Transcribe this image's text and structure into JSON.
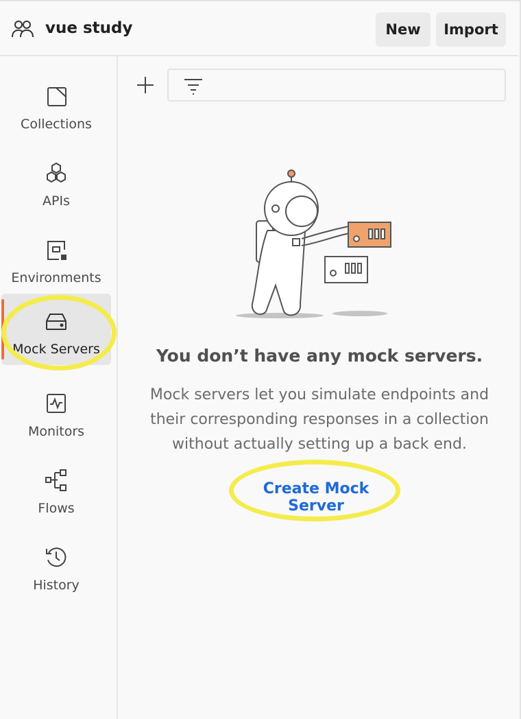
{
  "header": {
    "workspace_title": "vue study",
    "new_label": "New",
    "import_label": "Import"
  },
  "sidebar": {
    "items": [
      {
        "label": "Collections",
        "icon": "collections-icon"
      },
      {
        "label": "APIs",
        "icon": "apis-icon"
      },
      {
        "label": "Environments",
        "icon": "environments-icon"
      },
      {
        "label": "Mock Servers",
        "icon": "mock-servers-icon",
        "active": true
      },
      {
        "label": "Monitors",
        "icon": "monitors-icon"
      },
      {
        "label": "Flows",
        "icon": "flows-icon"
      },
      {
        "label": "History",
        "icon": "history-icon"
      }
    ]
  },
  "main": {
    "empty_title": "You don’t have any mock servers.",
    "empty_description": "Mock servers let you simulate endpoints and their corresponding responses in a collection without actually setting up a back end.",
    "create_link": "Create Mock Server"
  },
  "colors": {
    "accent": "#f26b3a",
    "link": "#1f6ad6",
    "highlight": "#f4ec4c"
  }
}
